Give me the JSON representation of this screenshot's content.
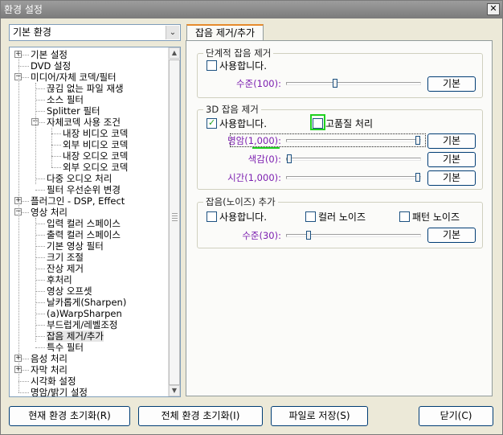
{
  "window": {
    "title": "환경 설정",
    "close_glyph": "✕"
  },
  "preset": {
    "selected": "기본 환경",
    "arrow_glyph": "⌄"
  },
  "tree": {
    "items": [
      {
        "label": "기본 설정",
        "depth": 0,
        "expander": "+"
      },
      {
        "label": "DVD 설정",
        "depth": 0,
        "expander": ""
      },
      {
        "label": "미디어/자체 코덱/필터",
        "depth": 0,
        "expander": "−"
      },
      {
        "label": "끊김 없는 파일 재생",
        "depth": 1,
        "expander": ""
      },
      {
        "label": "소스 필터",
        "depth": 1,
        "expander": ""
      },
      {
        "label": "Splitter 필터",
        "depth": 1,
        "expander": ""
      },
      {
        "label": "자체코덱 사용 조건",
        "depth": 1,
        "expander": "−"
      },
      {
        "label": "내장 비디오 코덱",
        "depth": 2,
        "expander": ""
      },
      {
        "label": "외부 비디오 코덱",
        "depth": 2,
        "expander": ""
      },
      {
        "label": "내장 오디오 코덱",
        "depth": 2,
        "expander": ""
      },
      {
        "label": "외부 오디오 코덱",
        "depth": 2,
        "expander": ""
      },
      {
        "label": "다중 오디오 처리",
        "depth": 1,
        "expander": ""
      },
      {
        "label": "필터 우선순위 변경",
        "depth": 1,
        "expander": ""
      },
      {
        "label": "플러그인 - DSP, Effect",
        "depth": 0,
        "expander": "+"
      },
      {
        "label": "영상 처리",
        "depth": 0,
        "expander": "−"
      },
      {
        "label": "입력 컬러 스페이스",
        "depth": 1,
        "expander": ""
      },
      {
        "label": "출력 컬러 스페이스",
        "depth": 1,
        "expander": ""
      },
      {
        "label": "기본 영상 필터",
        "depth": 1,
        "expander": ""
      },
      {
        "label": "크기 조절",
        "depth": 1,
        "expander": ""
      },
      {
        "label": "잔상 제거",
        "depth": 1,
        "expander": ""
      },
      {
        "label": "후처리",
        "depth": 1,
        "expander": ""
      },
      {
        "label": "영상 오프셋",
        "depth": 1,
        "expander": ""
      },
      {
        "label": "날카롭게(Sharpen)",
        "depth": 1,
        "expander": ""
      },
      {
        "label": "(a)WarpSharpen",
        "depth": 1,
        "expander": ""
      },
      {
        "label": "부드럽게/레벨조정",
        "depth": 1,
        "expander": ""
      },
      {
        "label": "잡음 제거/추가",
        "depth": 1,
        "expander": "",
        "selected": true
      },
      {
        "label": "특수 필터",
        "depth": 1,
        "expander": ""
      },
      {
        "label": "음성 처리",
        "depth": 0,
        "expander": "+"
      },
      {
        "label": "자막 처리",
        "depth": 0,
        "expander": "+"
      },
      {
        "label": "시각화 설정",
        "depth": 0,
        "expander": ""
      },
      {
        "label": "명암/밝기 설정",
        "depth": 0,
        "expander": ""
      }
    ]
  },
  "tab": {
    "label": "잡음 제거/추가"
  },
  "step_noise": {
    "title": "단계적 잡음 제거",
    "enable_label": "사용합니다.",
    "enabled": false,
    "level_label": "수준(100):",
    "level_value": 100,
    "reset_label": "기본"
  },
  "noise3d": {
    "title": "3D 잡음 제거",
    "enable_label": "사용합니다.",
    "enabled": true,
    "check_mark": "✓",
    "hq_label": "고품질 처리",
    "hq_enabled": false,
    "sliders": [
      {
        "label": "명암(1,000):",
        "value": 1000,
        "reset_label": "기본"
      },
      {
        "label": "색감(0):",
        "value": 0,
        "reset_label": "기본"
      },
      {
        "label": "시간(1,000):",
        "value": 1000,
        "reset_label": "기본"
      }
    ]
  },
  "add_noise": {
    "title": "잡음(노이즈) 추가",
    "enable_label": "사용합니다.",
    "color_label": "컬러 노이즈",
    "pattern_label": "패턴 노이즈",
    "level_label": "수준(30):",
    "level_value": 30,
    "reset_label": "기본"
  },
  "bottom": {
    "reset_current": "현재 환경 초기화(R)",
    "reset_all": "전체 환경 초기화(I)",
    "save_file": "파일로 저장(S)",
    "close": "닫기(C)"
  }
}
